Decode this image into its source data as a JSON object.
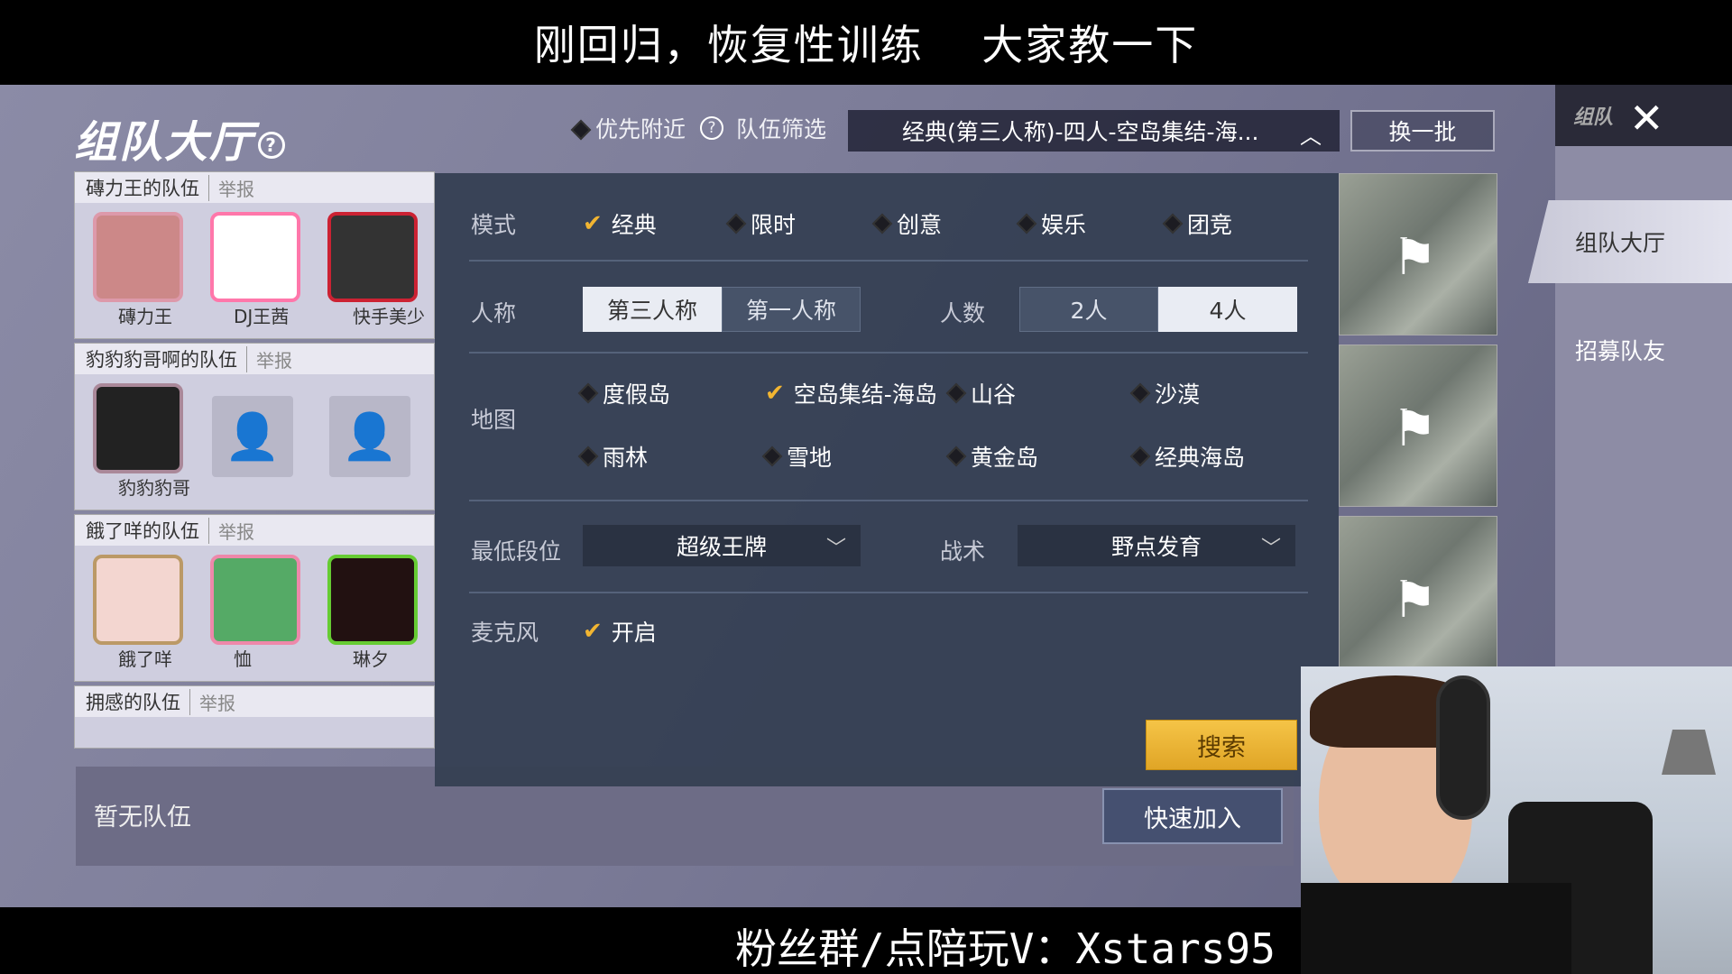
{
  "overlay": {
    "top_caption": "刚回归，恢复性训练　 大家教一下",
    "bottom_caption": "粉丝群/点陪玩V：Xstars95"
  },
  "header": {
    "title": "组队大厅",
    "priority_label": "优先附近",
    "filter_label": "队伍筛选",
    "filter_value": "经典(第三人称)-四人-空岛集结-海...",
    "refresh_button": "换一批"
  },
  "right_panel": {
    "top_label": "组队",
    "tabs": [
      {
        "label": "组队大厅",
        "active": true
      },
      {
        "label": "招募队友",
        "active": false
      }
    ]
  },
  "teams": [
    {
      "name": "磚力王的队伍",
      "report": "举报",
      "members": [
        "磚力王",
        "DJ王茜",
        "快手美少"
      ]
    },
    {
      "name": "豹豹豹哥啊的队伍",
      "report": "举报",
      "members": [
        "豹豹豹哥"
      ]
    },
    {
      "name": "餓了咩的队伍",
      "report": "举报",
      "members": [
        "餓了咩",
        "恤",
        "琳夕"
      ]
    },
    {
      "name": "拥感的队伍",
      "report": "举报",
      "members": []
    }
  ],
  "no_team_text": "暂无队伍",
  "quick_join": "快速加入",
  "filter_panel": {
    "mode_label": "模式",
    "modes": [
      {
        "label": "经典",
        "checked": true
      },
      {
        "label": "限时",
        "checked": false
      },
      {
        "label": "创意",
        "checked": false
      },
      {
        "label": "娱乐",
        "checked": false
      },
      {
        "label": "团竞",
        "checked": false
      }
    ],
    "perspective_label": "人称",
    "perspectives": [
      {
        "label": "第三人称",
        "active": true
      },
      {
        "label": "第一人称",
        "active": false
      }
    ],
    "count_label": "人数",
    "counts": [
      {
        "label": "2人",
        "active": false
      },
      {
        "label": "4人",
        "active": true
      }
    ],
    "map_label": "地图",
    "maps": [
      {
        "label": "度假岛",
        "checked": false
      },
      {
        "label": "空岛集结-海岛",
        "checked": true
      },
      {
        "label": "山谷",
        "checked": false
      },
      {
        "label": "沙漠",
        "checked": false
      },
      {
        "label": "雨林",
        "checked": false
      },
      {
        "label": "雪地",
        "checked": false
      },
      {
        "label": "黄金岛",
        "checked": false
      },
      {
        "label": "经典海岛",
        "checked": false
      }
    ],
    "rank_label": "最低段位",
    "rank_value": "超级王牌",
    "tactic_label": "战术",
    "tactic_value": "野点发育",
    "mic_label": "麦克风",
    "mic_value": "开启",
    "search_button": "搜索"
  },
  "colors": {
    "accent": "#f2b531",
    "panel": "#343e52",
    "search": "#f5c447"
  }
}
